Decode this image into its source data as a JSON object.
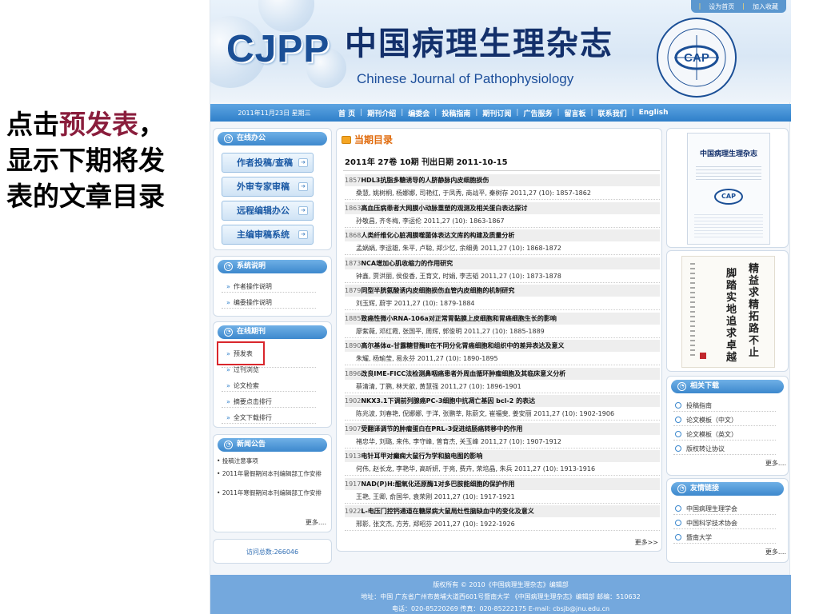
{
  "annotation": {
    "line1_a": "点击",
    "line1_hl": "预发表",
    "line1_b": "，",
    "line2": "显示下期将发",
    "line3": "表的文章目录"
  },
  "header": {
    "top_links": [
      "设为首页",
      "加入收藏"
    ],
    "logo_abbr": "CJPP",
    "logo_cn": "中国病理生理杂志",
    "logo_en": "Chinese Journal of Pathophysiology",
    "seal_text": "CAP"
  },
  "nav": {
    "date": "2011年11月23日 星期三",
    "items": [
      "首 页",
      "期刊介绍",
      "编委会",
      "投稿指南",
      "期刊订阅",
      "广告服务",
      "留言板",
      "联系我们",
      "English"
    ]
  },
  "sidebar": {
    "office": {
      "title": "在线办公",
      "buttons": [
        "作者投稿/查稿",
        "外审专家审稿",
        "远程编辑办公",
        "主编审稿系统"
      ]
    },
    "system": {
      "title": "系统说明",
      "links": [
        "作者操作说明",
        "编委操作说明"
      ]
    },
    "journal": {
      "title": "在线期刊",
      "links": [
        "预发表",
        "过刊浏览",
        "论文检索",
        "摘要点击排行",
        "全文下载排行"
      ]
    },
    "news": {
      "title": "新闻公告",
      "items": [
        "投稿注意事项",
        "2011年暑假期间本刊编辑部工作安排",
        "2011年寒假期间本刊编辑部工作安排"
      ],
      "more": "更多...."
    },
    "visits": "访问总数:266046"
  },
  "main": {
    "section_title": "当期目录",
    "issue_info": "2011年 27卷 10期  刊出日期 2011-10-15",
    "articles": [
      {
        "page": "1857",
        "title": "HDL3抗脂多糖诱导的人脐静脉内皮细胞损伤",
        "authors": "桑慧, 姚树桐, 杨娜娜, 司艳红, 于凤秀, 商战平, 秦树存   2011,27 (10): 1857-1862"
      },
      {
        "page": "1863",
        "title": "高血压病患者大网膜小动脉重塑的观测及相关蛋白表达探讨",
        "authors": "孙敬昌, 齐冬梅, 李运伦   2011,27 (10): 1863-1867"
      },
      {
        "page": "1868",
        "title": "人类纤维化心脏凋膜噬菌体表达文库的构建及质量分析",
        "authors": "孟娲娲, 李运雄, 朱平, 卢聪, 郑少忆, 余细勇   2011,27 (10): 1868-1872"
      },
      {
        "page": "1873",
        "title": "NCA增加心肌收缩力的作用研究",
        "authors": "钟鑫, 贾洪丽, 侯俊香, 王育文, 时娟, 李志韬   2011,27 (10): 1873-1878"
      },
      {
        "page": "1879",
        "title": "同型半胱氨酸诱内皮细胞损伤血管内皮细胞的机制研究",
        "authors": "刘玉辉, 蔚宇   2011,27 (10): 1879-1884"
      },
      {
        "page": "1885",
        "title": "致癌性微小RNA-106a对正常胃黏膜上皮细胞和胃癌细胞生长的影响",
        "authors": "廖紫薇, 邓红霞, 张国平, 周辉, 郭俊明   2011,27 (10): 1885-1889"
      },
      {
        "page": "1890",
        "title": "高尔基体α-甘露糖苷酶Ⅱ在不同分化胃癌细胞和组织中的差异表达及意义",
        "authors": "朱耀, 杨瑜莹, 易永芬   2011,27 (10): 1890-1895"
      },
      {
        "page": "1896",
        "title": "改良IME-FICC法检测鼻咽癌患者外周血循环肿瘤细胞及其临床意义分析",
        "authors": "蔡清清, 丁鹏, 林天歆, 黄慧强   2011,27 (10): 1896-1901"
      },
      {
        "page": "1902",
        "title": "NKX3.1下调前列腺癌PC-3细胞中抗凋亡基因 bcl-2 的表达",
        "authors": "陈兆波, 刘春艳, 倪娜娜, 于洋, 张鹏莘, 陈蔚文, 崔福斐, 姜安丽   2011,27 (10): 1902-1906"
      },
      {
        "page": "1907",
        "title": "受翻译调节的肿瘤蛋白在PRL-3促进结肠癌转移中的作用",
        "authors": "褚忠华, 刘璐, 来伟, 李守峰, 曾育杰, 关玉峰   2011,27 (10): 1907-1912"
      },
      {
        "page": "1913",
        "title": "电针耳甲对癫痫大鼠行为学和脑电图的影响",
        "authors": "何伟, 赵长龙, 李艳华, 高昕妍, 于亮, 费卉, 荣培晶, 朱兵   2011,27 (10): 1913-1916"
      },
      {
        "page": "1917",
        "title": "NAD(P)H:醌氧化还原酶1对多巴胺能细胞的保护作用",
        "authors": "王艳, 王卿, 俞国华, 袁荣刚   2011,27 (10): 1917-1921"
      },
      {
        "page": "1922",
        "title": "L-电压门控钙通道在糖尿病大鼠局灶性脑缺血中的变化及意义",
        "authors": "邢影, 张文杰, 方芳, 郑昭芬   2011,27 (10): 1922-1926"
      }
    ],
    "more": "更多>>"
  },
  "right": {
    "cover_title": "中国病理生理杂志",
    "calligraphy_right": "精益求精 拓路不止",
    "calligraphy_left": "脚踏实地 追求卓越",
    "downloads": {
      "title": "相关下载",
      "links": [
        "投稿指南",
        "论文模板（中文）",
        "论文模板（英文）",
        "版权转让协议"
      ],
      "more": "更多...."
    },
    "friends": {
      "title": "友情链接",
      "links": [
        "中国病理生理学会",
        "中国科学技术协会",
        "暨南大学"
      ],
      "more": "更多...."
    }
  },
  "footer": {
    "line1": "版权所有 © 2010《中国病理生理杂志》编辑部",
    "line2": "地址：中国 广东省广州市黄埔大道西601号暨南大学 《中国病理生理杂志》编辑部 邮编：510632",
    "line3": "电话：020-85220269 传真：020-85222175 E-mail: cbsjb@jnu.edu.cn"
  },
  "colors": {
    "accent": "#3c88cd",
    "highlight_box": "#d9262c",
    "annotation_highlight": "#8a1d3c",
    "section_title": "#e06a0b"
  }
}
